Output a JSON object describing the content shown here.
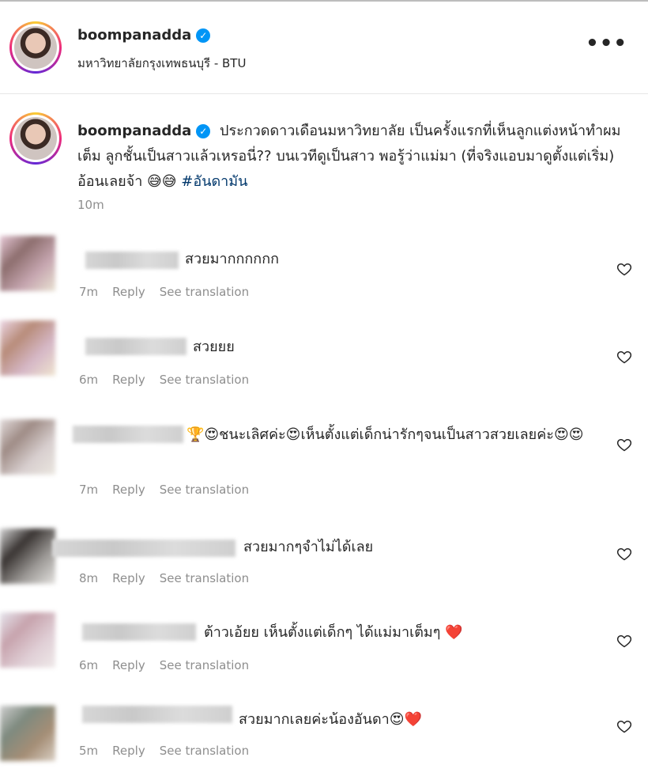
{
  "post": {
    "username": "boompanadda",
    "location": "มหาวิทยาลัยกรุงเทพธนบุรี - BTU",
    "caption_text": "ประกวดดาวเดือนมหาวิทยาลัย เป็นครั้งแรกที่เห็นลูกแต่งหน้าทำผมเต็ม ลูกชั้นเป็นสาวแล้วเหรอนี่?? บนเวทีดูเป็นสาว พอรู้ว่าแม่มา (ที่จริงแอบมาดูตั้งแต่เริ่ม) อ้อนเลยจ้า 😅😅",
    "hashtag": "#อันดามัน",
    "time": "10m"
  },
  "comments": [
    {
      "text": "สวยมากกกกกก",
      "time": "7m"
    },
    {
      "text": "สวยยย",
      "time": "6m"
    },
    {
      "text": "🏆😍ชนะเลิศค่ะ😍เห็นตั้งแต่เด็กน่ารักๆจนเป็นสาวสวยเลยค่ะ😍😍",
      "time": "7m"
    },
    {
      "text": "สวยมากๆจำไม่ได้เลย",
      "time": "8m"
    },
    {
      "text": "ต้าวเอ้ยย เห็นตั้งแต่เด็กๆ ได้แม่มาเต็มๆ ❤️",
      "time": "6m"
    },
    {
      "text": "สวยมากเลยค่ะน้องอันดา😍❤️",
      "time": "5m"
    }
  ],
  "labels": {
    "reply": "Reply",
    "see_translation": "See translation",
    "more": "•••",
    "verified": "✓"
  },
  "colors": {
    "verified": "#0095f6",
    "hashtag": "#00376b",
    "secondary_text": "#8e8e8e"
  }
}
